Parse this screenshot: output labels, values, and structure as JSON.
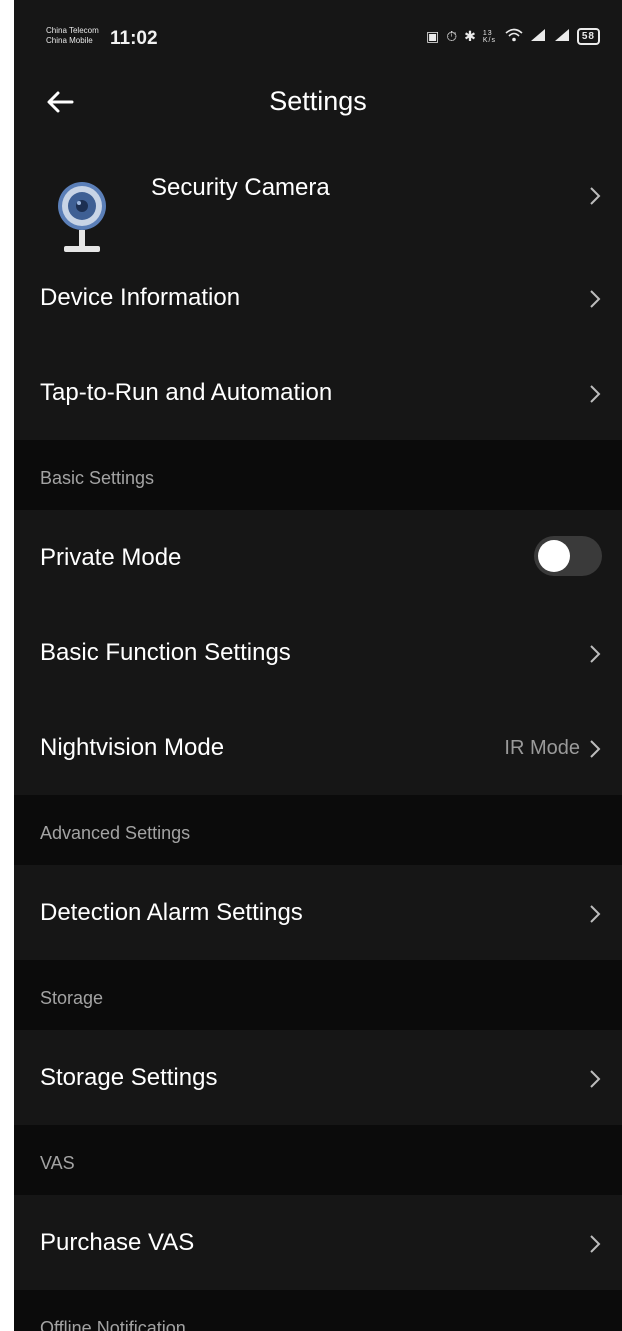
{
  "status_bar": {
    "carrier_1": "China Telecom",
    "carrier_2": "China Mobile",
    "time": "11:02",
    "icons": [
      "nfc-icon",
      "alarm-icon",
      "bluetooth-icon",
      "network-speed-icon",
      "wifi-icon",
      "signal-icon",
      "signal-icon"
    ],
    "network_speed": "13 K/s",
    "battery": "58"
  },
  "header": {
    "title": "Settings"
  },
  "device": {
    "name": "Security Camera"
  },
  "rows": {
    "device_information": "Device Information",
    "tap_to_run": "Tap-to-Run and Automation",
    "private_mode": "Private Mode",
    "basic_function": "Basic Function Settings",
    "nightvision": "Nightvision Mode",
    "nightvision_value": "IR Mode",
    "detection_alarm": "Detection Alarm Settings",
    "storage_settings": "Storage Settings",
    "purchase_vas": "Purchase VAS"
  },
  "toggles": {
    "private_mode_on": false
  },
  "sections": {
    "basic": "Basic Settings",
    "advanced": "Advanced Settings",
    "storage": "Storage",
    "vas": "VAS",
    "offline": "Offline Notification"
  },
  "colors": {
    "background": "#161616",
    "section_background": "#0b0b0b",
    "text": "#ffffff",
    "muted_text": "#a3a3a3",
    "accent_camera": "#5b7fb8"
  }
}
